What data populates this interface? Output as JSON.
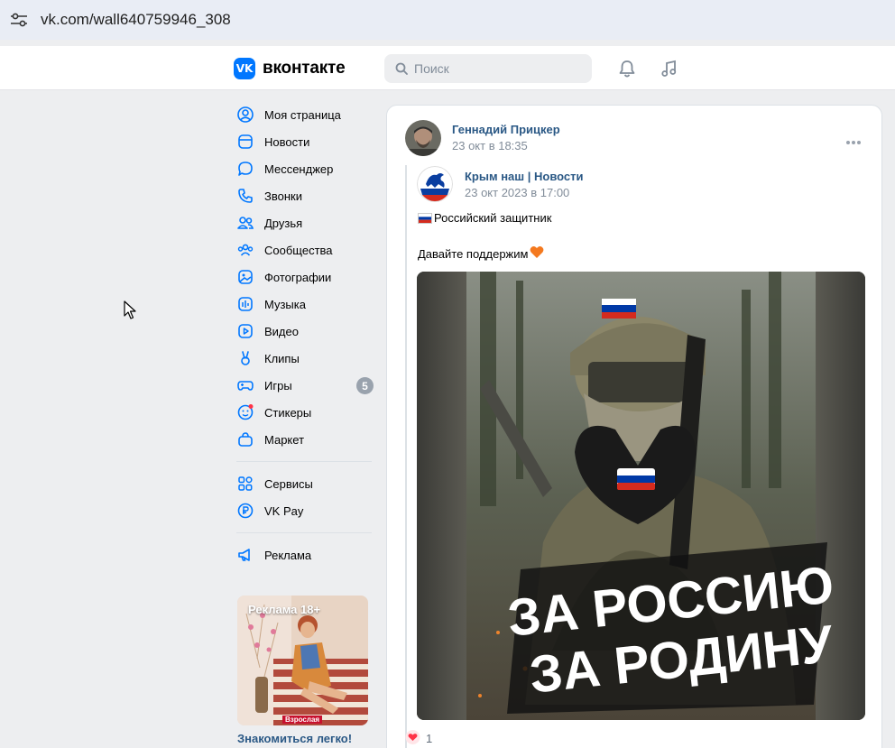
{
  "browser": {
    "url": "vk.com/wall640759946_308"
  },
  "header": {
    "logo_text": "вконтакте",
    "logo_mark": "VK",
    "search_placeholder": "Поиск"
  },
  "sidebar": {
    "items": [
      {
        "label": "Моя страница",
        "icon": "user-circle-icon"
      },
      {
        "label": "Новости",
        "icon": "news-icon"
      },
      {
        "label": "Мессенджер",
        "icon": "message-icon"
      },
      {
        "label": "Звонки",
        "icon": "phone-icon"
      },
      {
        "label": "Друзья",
        "icon": "friends-icon"
      },
      {
        "label": "Сообщества",
        "icon": "communities-icon"
      },
      {
        "label": "Фотографии",
        "icon": "photo-icon"
      },
      {
        "label": "Музыка",
        "icon": "music-icon"
      },
      {
        "label": "Видео",
        "icon": "video-icon"
      },
      {
        "label": "Клипы",
        "icon": "clips-icon"
      },
      {
        "label": "Игры",
        "icon": "games-icon",
        "badge": "5"
      },
      {
        "label": "Стикеры",
        "icon": "stickers-icon"
      },
      {
        "label": "Маркет",
        "icon": "market-icon"
      }
    ],
    "items2": [
      {
        "label": "Сервисы",
        "icon": "services-icon"
      },
      {
        "label": "VK Pay",
        "icon": "vkpay-icon"
      }
    ],
    "items3": [
      {
        "label": "Реклама",
        "icon": "megaphone-icon"
      }
    ],
    "ad": {
      "tag": "Реклама 18+",
      "title": "Знакомиться легко!",
      "sub_label": "Взрослая"
    }
  },
  "post": {
    "author": "Геннадий Прицкер",
    "date": "23 окт в 18:35",
    "source": {
      "name": "Крым наш | Новости",
      "date": "23 окт 2023 в 17:00"
    },
    "text_line1": "Российский защитник",
    "text_line2": "Давайте поддержим",
    "image_caption_1": "ЗА РОССИЮ",
    "image_caption_2": "ЗА РОДИНУ",
    "likes": "1"
  },
  "colors": {
    "accent": "#0077ff",
    "link": "#2a5885",
    "secondary": "#818c99",
    "like": "#ff3347"
  }
}
